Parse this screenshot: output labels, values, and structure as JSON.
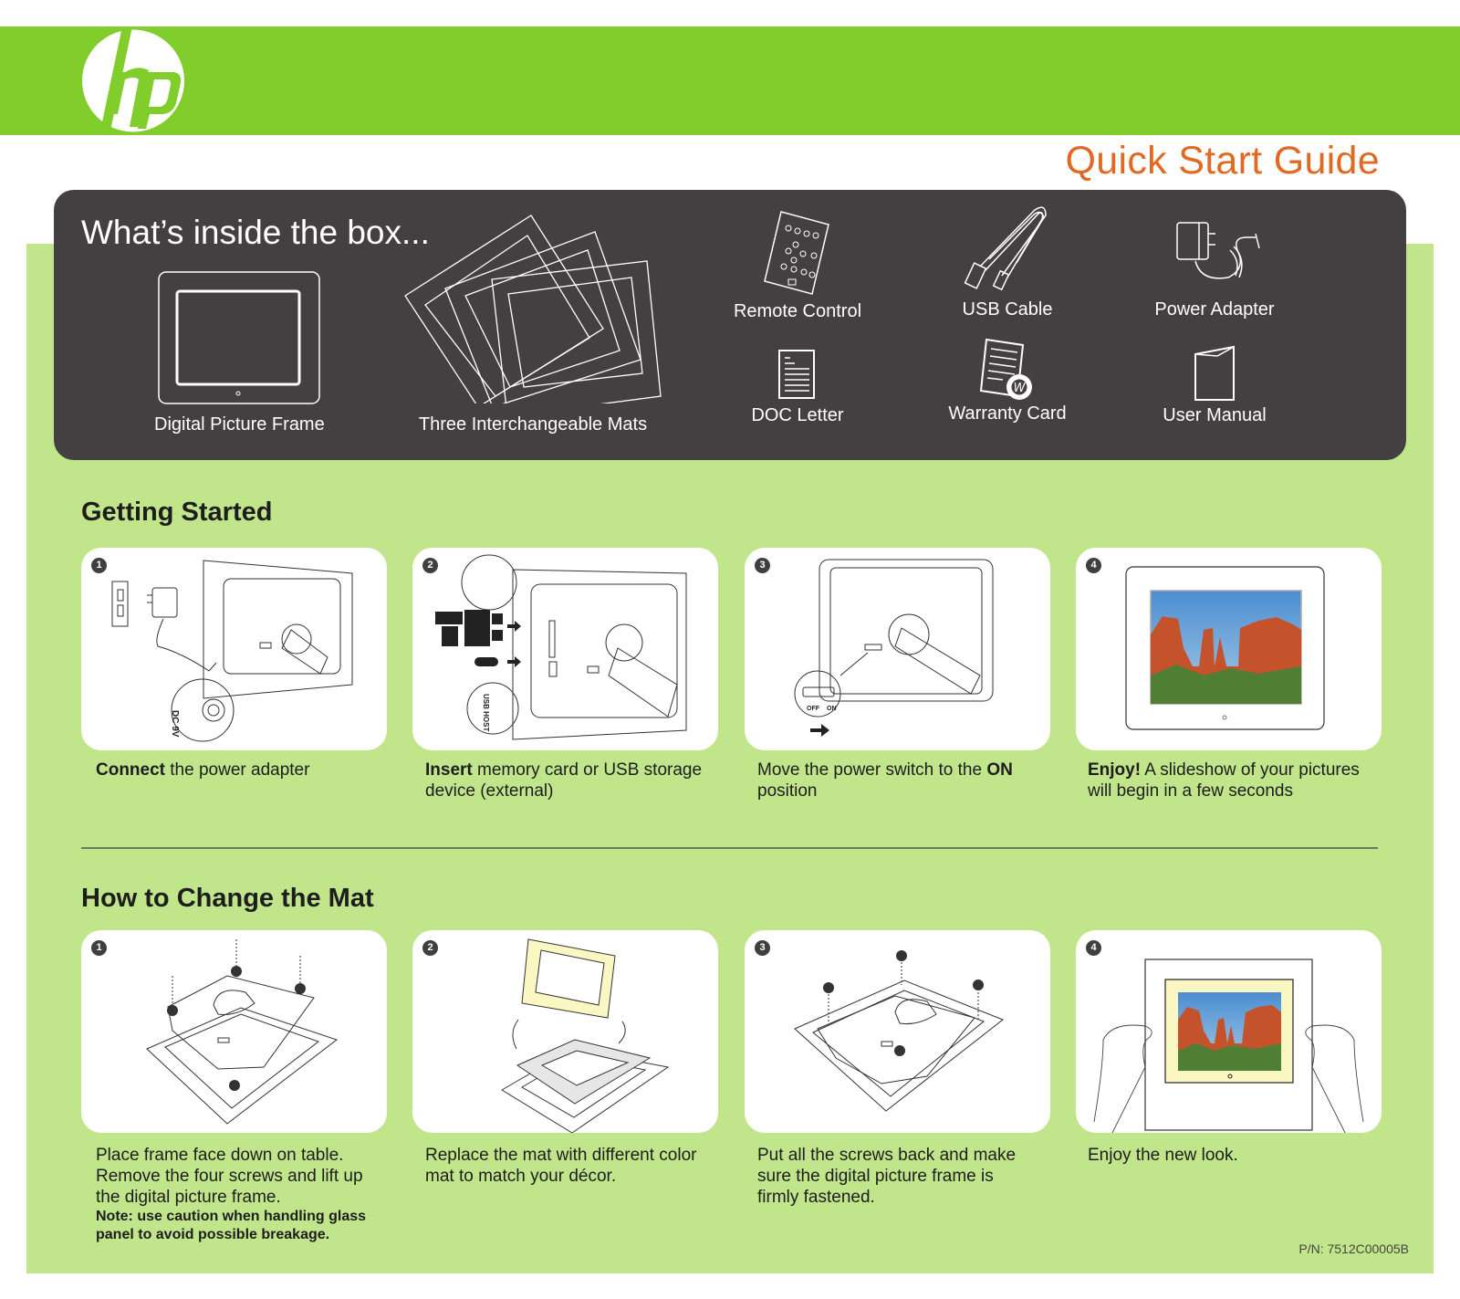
{
  "header": {
    "brand": "hp",
    "logo_icon": "hp-logo-icon",
    "guide_title": "Quick Start Guide",
    "brand_color": "#81cd2b",
    "title_color": "#e06a23"
  },
  "box_contents": {
    "title": "What’s inside the box...",
    "items": [
      {
        "label": "Digital Picture Frame",
        "icon": "picture-frame-icon"
      },
      {
        "label": "Three Interchangeable Mats",
        "icon": "mats-icon"
      },
      {
        "label": "Remote Control",
        "icon": "remote-control-icon"
      },
      {
        "label": "USB Cable",
        "icon": "usb-cable-icon"
      },
      {
        "label": "Power Adapter",
        "icon": "power-adapter-icon"
      },
      {
        "label": "DOC Letter",
        "icon": "document-icon"
      },
      {
        "label": "Warranty Card",
        "icon": "warranty-card-icon"
      },
      {
        "label": "User Manual",
        "icon": "user-manual-icon"
      }
    ]
  },
  "getting_started": {
    "title": "Getting Started",
    "steps": [
      {
        "number": "1",
        "bold": "Connect",
        "text": " the power adapter",
        "illustration": "connect-adapter-illustration",
        "labels": [
          "DC 9V"
        ]
      },
      {
        "number": "2",
        "bold": "Insert",
        "text": " memory card or USB storage device (external)",
        "illustration": "insert-card-illustration",
        "labels": [
          "USB HOST"
        ]
      },
      {
        "number": "3",
        "pre": "Move the power switch to the ",
        "bold": "ON",
        "text": " position",
        "illustration": "power-switch-illustration",
        "labels": [
          "OFF",
          "ON"
        ]
      },
      {
        "number": "4",
        "bold": "Enjoy!",
        "text": " A slideshow of your pictures will begin in a few seconds",
        "illustration": "slideshow-illustration"
      }
    ]
  },
  "change_mat": {
    "title": "How to Change the Mat",
    "steps": [
      {
        "number": "1",
        "text": "Place frame face down on table. Remove the four screws and lift up the digital picture frame.",
        "note": "Note:  use caution when handling glass panel to avoid possible breakage.",
        "illustration": "remove-screws-illustration"
      },
      {
        "number": "2",
        "text": "Replace the mat with different color mat to match your décor.",
        "illustration": "replace-mat-illustration"
      },
      {
        "number": "3",
        "text": "Put all the screws back and make sure the digital picture frame is firmly fastened.",
        "illustration": "replace-screws-illustration"
      },
      {
        "number": "4",
        "text": "Enjoy the new look.",
        "illustration": "new-look-illustration"
      }
    ]
  },
  "footer": {
    "part_number": "P/N: 7512C00005B"
  }
}
